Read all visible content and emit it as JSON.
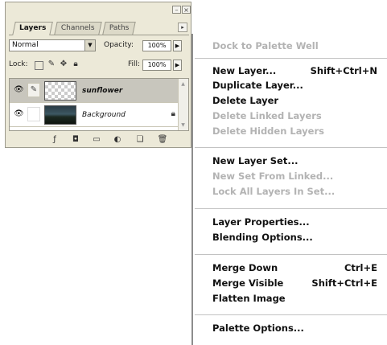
{
  "palette": {
    "tabs": [
      "Layers",
      "Channels",
      "Paths"
    ],
    "window_buttons": [
      "minimize",
      "close"
    ],
    "menu_arrow": "▸",
    "blend_mode": "Normal",
    "opacity_label": "Opacity:",
    "opacity_value": "100%",
    "lock_label": "Lock:",
    "fill_label": "Fill:",
    "fill_value": "100%",
    "lock_icons": [
      "lock-transparent-icon",
      "lock-paint-icon",
      "lock-move-icon",
      "lock-all-icon"
    ],
    "layers": [
      {
        "name": "sunflower",
        "visible": true,
        "linked_brush": true,
        "selected": true
      },
      {
        "name": "Background",
        "visible": true,
        "locked": true,
        "selected": false
      }
    ],
    "bottom_icons": [
      "layer-style-icon",
      "add-mask-icon",
      "new-set-icon",
      "adjustment-layer-icon",
      "new-layer-icon",
      "trash-icon"
    ]
  },
  "menu": {
    "items": [
      {
        "label": "Dock to Palette Well",
        "shortcut": "",
        "enabled": false
      },
      {
        "label": "New Layer...",
        "shortcut": "Shift+Ctrl+N",
        "enabled": true
      },
      {
        "label": "Duplicate Layer...",
        "shortcut": "",
        "enabled": true
      },
      {
        "label": "Delete Layer",
        "shortcut": "",
        "enabled": true
      },
      {
        "label": "Delete Linked Layers",
        "shortcut": "",
        "enabled": false
      },
      {
        "label": "Delete Hidden Layers",
        "shortcut": "",
        "enabled": false
      },
      {
        "label": "New Layer Set...",
        "shortcut": "",
        "enabled": true
      },
      {
        "label": "New Set From Linked...",
        "shortcut": "",
        "enabled": false
      },
      {
        "label": "Lock All Layers In Set...",
        "shortcut": "",
        "enabled": false
      },
      {
        "label": "Layer Properties...",
        "shortcut": "",
        "enabled": true
      },
      {
        "label": "Blending Options...",
        "shortcut": "",
        "enabled": true
      },
      {
        "label": "Merge Down",
        "shortcut": "Ctrl+E",
        "enabled": true
      },
      {
        "label": "Merge Visible",
        "shortcut": "Shift+Ctrl+E",
        "enabled": true
      },
      {
        "label": "Flatten Image",
        "shortcut": "",
        "enabled": true
      },
      {
        "label": "Palette Options...",
        "shortcut": "",
        "enabled": true
      }
    ]
  }
}
